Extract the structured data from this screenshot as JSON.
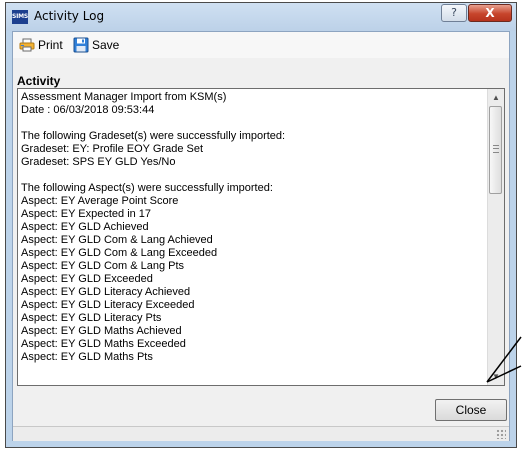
{
  "window": {
    "app_icon_text": "SIMS",
    "title": "Activity Log",
    "help_glyph": "?",
    "close_glyph": "X"
  },
  "toolbar": {
    "print_label": "Print",
    "save_label": "Save"
  },
  "activity": {
    "label": "Activity",
    "lines": [
      "Assessment Manager Import from KSM(s)",
      "Date : 06/03/2018 09:53:44",
      "",
      "The following Gradeset(s) were successfully imported:",
      "Gradeset: EY: Profile EOY Grade Set",
      "Gradeset: SPS EY GLD Yes/No",
      "",
      "The following Aspect(s) were successfully imported:",
      "Aspect: EY Average Point Score",
      "Aspect: EY Expected in 17",
      "Aspect: EY GLD Achieved",
      "Aspect: EY GLD Com & Lang Achieved",
      "Aspect: EY GLD Com & Lang Exceeded",
      "Aspect: EY GLD Com & Lang Pts",
      "Aspect: EY GLD Exceeded",
      "Aspect: EY GLD Literacy Achieved",
      "Aspect: EY GLD Literacy Exceeded",
      "Aspect: EY GLD Literacy Pts",
      "Aspect: EY GLD Maths Achieved",
      "Aspect: EY GLD Maths Exceeded",
      "Aspect: EY GLD Maths Pts"
    ]
  },
  "scrollbar": {
    "up_arrow": "▲",
    "down_arrow": "▼"
  },
  "buttons": {
    "close_label": "Close"
  },
  "icons": {
    "print": "printer-icon",
    "save": "floppy-disk-icon"
  },
  "colors": {
    "title_bar": "#bcd3ea",
    "close_x": "#c7452c"
  }
}
